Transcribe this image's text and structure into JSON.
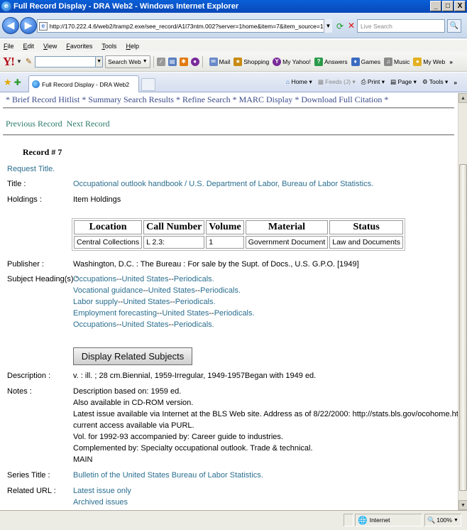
{
  "window": {
    "title": "Full Record Display - DRA Web2 - Windows Internet Explorer",
    "min": "_",
    "max": "□",
    "close": "X"
  },
  "address": {
    "url": "http://170.222.4.6/web2/tramp2.exe/see_record/A1l73ntm.002?server=1home&item=7&item_source=1home",
    "search_placeholder": "Live Search"
  },
  "menu": [
    "File",
    "Edit",
    "View",
    "Favorites",
    "Tools",
    "Help"
  ],
  "yahoo_toolbar": {
    "logo": "Y!",
    "search_button": "Search Web",
    "items": [
      "Mail",
      "Shopping",
      "My Yahoo!",
      "Answers",
      "Games",
      "Music",
      "My Web"
    ]
  },
  "tabs": {
    "active": "Full Record Display - DRA Web2",
    "commands": {
      "home": "Home",
      "feeds": "Feeds (J)",
      "print": "Print",
      "page": "Page",
      "tools": "Tools"
    }
  },
  "page": {
    "nav_links": [
      "Brief Record Hitlist",
      "Summary Search Results",
      "Refine Search",
      "MARC Display",
      "Download Full Citation"
    ],
    "record_nav": [
      "Previous Record",
      "Next Record"
    ],
    "record_number": "Record # 7",
    "request_title": "Request Title.",
    "title_label": "Title :",
    "title_value": "Occupational outlook handbook / U.S. Department of Labor, Bureau of Labor Statistics.",
    "holdings_label": "Holdings :",
    "holdings_value": "Item Holdings",
    "holdings_table": {
      "headers": [
        "Location",
        "Call Number",
        "Volume",
        "Material",
        "Status"
      ],
      "rows": [
        [
          "Central Collections",
          "L 2.3:",
          "1",
          "Government Document",
          "Law and Documents"
        ]
      ]
    },
    "publisher_label": "Publisher :",
    "publisher_value": "Washington, D.C. : The Bureau : For sale by the Supt. of Docs., U.S. G.P.O. [1949]",
    "subject_label": "Subject Heading(s) :",
    "subjects": [
      [
        "Occupations",
        "United States",
        "Periodicals."
      ],
      [
        "Vocational guidance",
        "United States",
        "Periodicals."
      ],
      [
        "Labor supply",
        "United States",
        "Periodicals."
      ],
      [
        "Employment forecasting",
        "United States",
        "Periodicals."
      ],
      [
        "Occupations",
        "United States",
        "Periodicals."
      ]
    ],
    "subject_separator": "--",
    "display_related_button": "Display Related Subjects",
    "description_label": "Description :",
    "description_value": "v. : ill. ; 28 cm.Biennial, 1959-Irregular, 1949-1957Began with 1949 ed.",
    "notes_label": "Notes :",
    "notes": [
      "Description based on: 1959 ed.",
      "Also available in CD-ROM version.",
      "Latest issue available via Internet at the BLS Web site. Address as of 8/22/2000: http://stats.bls.gov/ocohome.htm ;",
      "current access available via PURL.",
      "Vol. for 1992-93 accompanied by: Career guide to industries.",
      "Complemented by: Specialty occupational outlook. Trade & technical.",
      "MAIN"
    ],
    "series_label": "Series Title :",
    "series_value": "Bulletin of the United States Bureau of Labor Statistics.",
    "related_url_label": "Related URL :",
    "related_urls": [
      "Latest issue only",
      "Archived issues"
    ]
  },
  "status": {
    "zone": "Internet",
    "zoom": "100%"
  }
}
